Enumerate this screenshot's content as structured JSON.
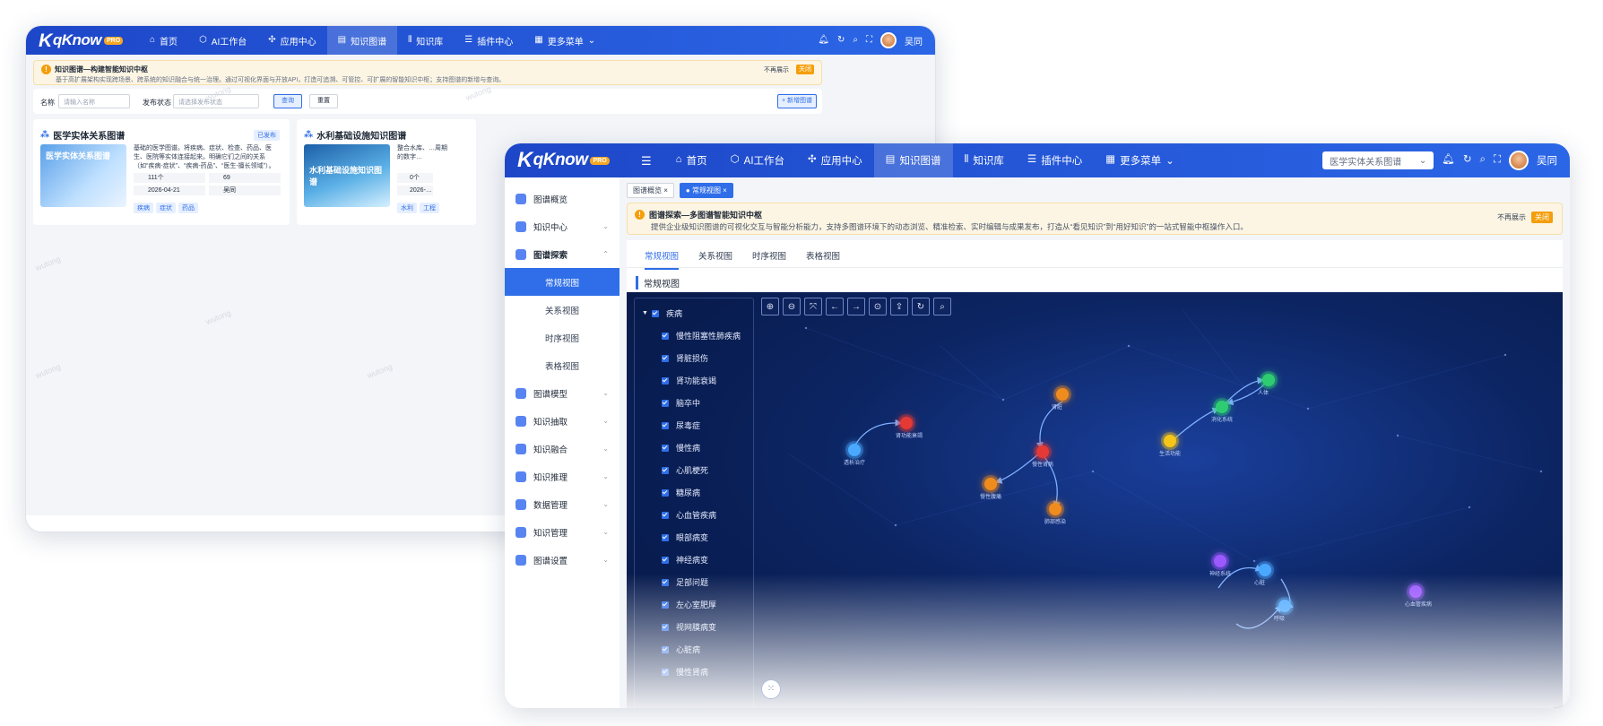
{
  "app": {
    "brand": "qKnow",
    "badge": "PRO",
    "user": "吴同"
  },
  "nav": [
    "首页",
    "AI工作台",
    "应用中心",
    "知识图谱",
    "知识库",
    "插件中心",
    "更多菜单"
  ],
  "nav_active_back": "知识图谱",
  "nav_active_front": "知识图谱",
  "back_window": {
    "notice_title": "知识图谱—构建智能知识中枢",
    "notice_desc": "基于高扩展架构实现跨场景、跨系统的知识融合与统一治理。通过可视化界面与开放API，打造可追溯、可管控、可扩展的智能知识中枢；支持图谱的新增与查询。",
    "notice_hide": "不再展示",
    "notice_close": "关闭",
    "filter": {
      "name_label": "名称",
      "name_placeholder": "请输入名称",
      "status_label": "发布状态",
      "status_placeholder": "请选择发布状态",
      "query": "查询",
      "reset": "重置",
      "add": "+ 新增图谱"
    },
    "cards": [
      {
        "title": "医学实体关系图谱",
        "status": "已发布",
        "thumb": "医学实体关系图谱",
        "desc": "基础的医学图谱。将疾病、症状、检查、药品、医生、医院等实体连接起来。明确它们之间的关系（如“疾病-症状”、“疾病-药品”、“医生-擅长领域”）。",
        "entities": "111个",
        "relations": "69",
        "date": "2026-04-21",
        "owner": "吴同",
        "tags": [
          "疾病",
          "症状",
          "药品"
        ]
      },
      {
        "title": "水利基础设施知识图谱",
        "thumb": "水利基础设施知识图谱",
        "desc": "整合水库、…周期的数字…",
        "entities": "0个",
        "date": "2026-…",
        "tags": [
          "水利",
          "工程"
        ]
      }
    ],
    "watermark": "wutong"
  },
  "front_window": {
    "graph_select": "医学实体关系图谱",
    "sidebar": [
      {
        "label": "图谱概览"
      },
      {
        "label": "知识中心",
        "arrow": "⌄"
      },
      {
        "label": "图谱探索",
        "arrow": "⌃",
        "children": [
          "常规视图",
          "关系视图",
          "时序视图",
          "表格视图"
        ]
      },
      {
        "label": "图谱模型",
        "arrow": "⌄"
      },
      {
        "label": "知识抽取",
        "arrow": "⌄"
      },
      {
        "label": "知识融合",
        "arrow": "⌄"
      },
      {
        "label": "知识推理",
        "arrow": "⌄"
      },
      {
        "label": "数据管理",
        "arrow": "⌄"
      },
      {
        "label": "知识管理",
        "arrow": "⌄"
      },
      {
        "label": "图谱设置",
        "arrow": "⌄"
      }
    ],
    "open_tabs": [
      "图谱概览 ×",
      "● 常规视图 ×"
    ],
    "notice_title": "图谱探索—多图谱智能知识中枢",
    "notice_desc": "提供企业级知识图谱的可视化交互与智能分析能力，支持多图谱环境下的动态浏览、精准检索、实时编辑与成果发布，打造从“看见知识”到“用好知识”的一站式智能中枢操作入口。",
    "notice_hide": "不再展示",
    "notice_close": "关闭",
    "view_tabs": [
      "常规视图",
      "关系视图",
      "时序视图",
      "表格视图"
    ],
    "section_title": "常规视图",
    "tree_root": "疾病",
    "tree_items": [
      "慢性阻塞性肺疾病",
      "肾脏损伤",
      "肾功能衰竭",
      "脑卒中",
      "尿毒症",
      "慢性病",
      "心肌梗死",
      "糖尿病",
      "心血管疾病",
      "眼部病变",
      "神经病变",
      "足部问题",
      "左心室肥厚",
      "视网膜病变",
      "心脏病",
      "慢性肾病"
    ],
    "toolbar_icons": [
      "zoom-in-icon",
      "zoom-out-icon",
      "fit-icon",
      "back-icon",
      "forward-icon",
      "center-icon",
      "export-icon",
      "refresh-icon",
      "search-icon"
    ],
    "graph_nodes": [
      {
        "label": "透析治疗",
        "color": "#4aa8ff"
      },
      {
        "label": "肾功能衰竭",
        "color": "#e53935"
      },
      {
        "label": "肾脏",
        "color": "#f08c1e"
      },
      {
        "label": "慢性肾病",
        "color": "#e53935"
      },
      {
        "label": "慢性腹痛",
        "color": "#f08c1e"
      },
      {
        "label": "肺部感染",
        "color": "#f08c1e"
      },
      {
        "label": "生活功能",
        "color": "#f5c518"
      },
      {
        "label": "消化系统",
        "color": "#2ecc71"
      },
      {
        "label": "人体",
        "color": "#2ecc71"
      },
      {
        "label": "神经系统",
        "color": "#9b59ff"
      },
      {
        "label": "心脏",
        "color": "#4aa8ff"
      },
      {
        "label": "呼吸",
        "color": "#4aa8ff"
      },
      {
        "label": "心血管疾病",
        "color": "#9b59ff"
      }
    ]
  }
}
